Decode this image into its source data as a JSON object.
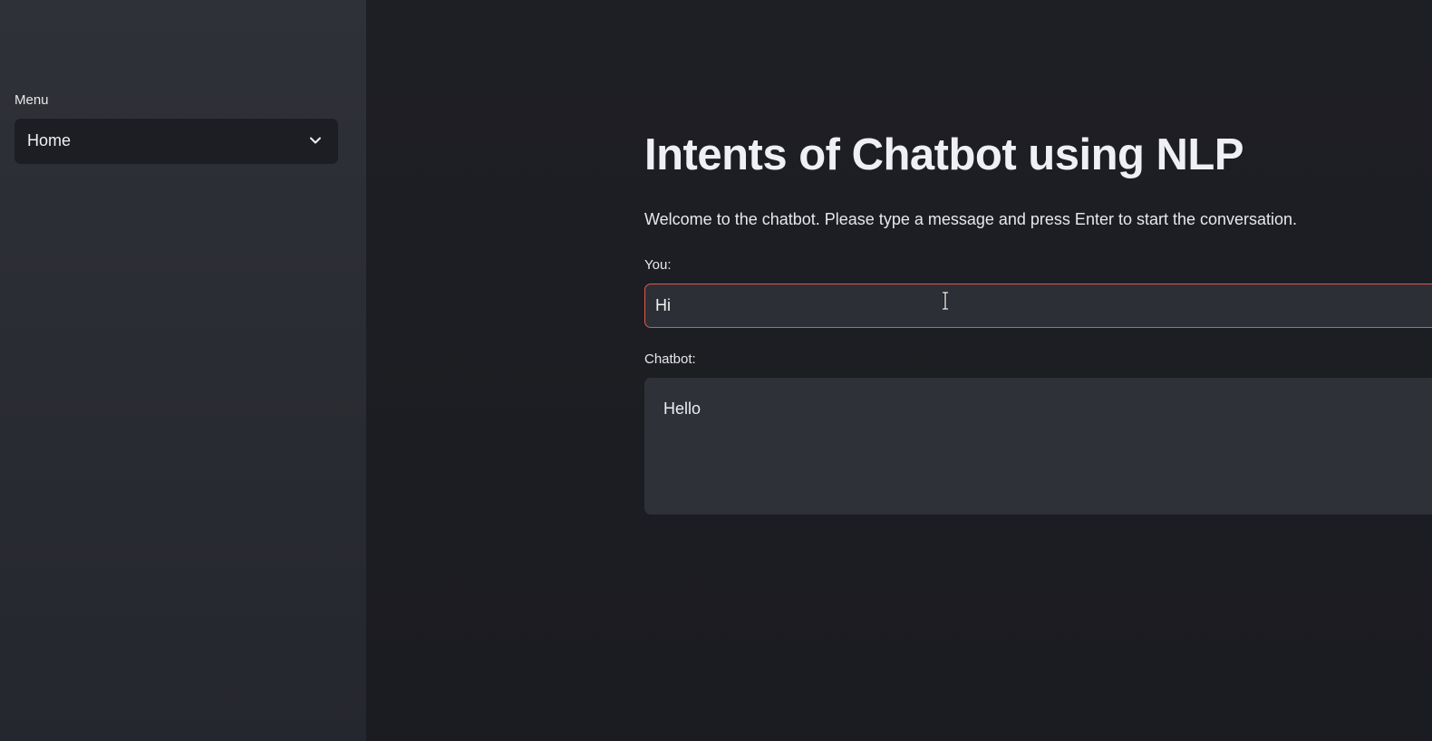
{
  "sidebar": {
    "menu_label": "Menu",
    "menu_selected": "Home",
    "menu_icon": "chevron-down-icon"
  },
  "main": {
    "title": "Intents of Chatbot using NLP",
    "intro": "Welcome to the chatbot. Please type a message and press Enter to start the conversation.",
    "you_label": "You:",
    "you_value": "Hi",
    "chatbot_label": "Chatbot:",
    "chatbot_value": "Hello"
  },
  "colors": {
    "background": "#1b1c21",
    "sidebar": "#2c2e35",
    "input_focus_border": "#e0584f",
    "text": "#eef0f4"
  }
}
